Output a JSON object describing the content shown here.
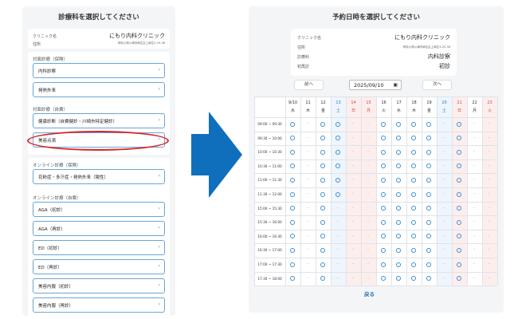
{
  "left_panel": {
    "title": "診療科を選択してください",
    "clinic": {
      "name_label": "クリニック名",
      "name": "にもり内科クリニック",
      "address_label": "住所",
      "address": "神奈川県川崎市麻生区上麻生5-29-36"
    },
    "sections": [
      {
        "title": "対面診療（保険）",
        "options": [
          "内科診察",
          "発熱外来"
        ]
      },
      {
        "title": "対面診療（自費）",
        "options": [
          "健康診断（自費健診・川崎市特定健診）",
          "美容点滴"
        ]
      },
      {
        "title": "オンライン診療（保険）",
        "options": [
          "花粉症・多汗症・発熱外来（陽性）"
        ]
      },
      {
        "title": "オンライン診療（自費）",
        "options": [
          "AGA（初診）",
          "AGA（再診）",
          "ED（初診）",
          "ED（再診）",
          "美容内服（初診）",
          "美容内服（再診）"
        ]
      }
    ],
    "chevron": "›",
    "highlighted_option": "美容点滴"
  },
  "arrow": {
    "color": "#0f6fbd"
  },
  "right_panel": {
    "title": "予約日時を選択してください",
    "clinic": {
      "name_label": "クリニック名",
      "name": "にもり内科クリニック",
      "address_label": "住所",
      "address": "神奈川県川崎市麻生区上麻生5-29-36",
      "dept_label": "診療科",
      "dept": "内科診察",
      "visit_label": "初再診",
      "visit": "初診"
    },
    "prev_label": "前へ",
    "next_label": "次へ",
    "date_value": "2025/09/10",
    "calendar_icon": "calendar-icon",
    "days": [
      {
        "d": "9/10",
        "w": "水",
        "color": "#333333"
      },
      {
        "d": "11",
        "w": "木",
        "color": "#333333"
      },
      {
        "d": "12",
        "w": "金",
        "color": "#333333"
      },
      {
        "d": "13",
        "w": "土",
        "color": "#2a7fc9"
      },
      {
        "d": "14",
        "w": "日",
        "color": "#d64545"
      },
      {
        "d": "15",
        "w": "月",
        "color": "#d64545"
      },
      {
        "d": "16",
        "w": "火",
        "color": "#333333"
      },
      {
        "d": "17",
        "w": "水",
        "color": "#333333"
      },
      {
        "d": "18",
        "w": "木",
        "color": "#333333"
      },
      {
        "d": "19",
        "w": "金",
        "color": "#333333"
      },
      {
        "d": "20",
        "w": "土",
        "color": "#2a7fc9"
      },
      {
        "d": "21",
        "w": "日",
        "color": "#d64545"
      },
      {
        "d": "22",
        "w": "月",
        "color": "#333333"
      },
      {
        "d": "23",
        "w": "火",
        "color": "#d64545"
      }
    ],
    "times": [
      "09:00 ~ 09:30",
      "09:30 ~ 10:00",
      "10:00 ~ 10:30",
      "10:30 ~ 11:00",
      "11:00 ~ 11:30",
      "11:30 ~ 12:00",
      "15:00 ~ 15:30",
      "15:30 ~ 16:00",
      "16:00 ~ 16:30",
      "16:30 ~ 17:00",
      "17:00 ~ 17:30",
      "17:30 ~ 18:00"
    ],
    "slots": [
      "o-oo--oooo-o-",
      "o-oo--oooo-o-",
      "o-oo--oooo-o-",
      "o-oo--oooo-o-",
      "o-oo--oooo-o-",
      "o-oo--oooo-o-",
      "o-o---oooo-o-",
      "o-o---oooo-o-",
      "o-o---oooo-o-",
      "o-o---oooo-o-",
      "o-o---oooo-o-",
      "o-o---oooo-o-"
    ],
    "available_mark": "○",
    "unavailable_mark": "-",
    "back_label": "戻る"
  }
}
